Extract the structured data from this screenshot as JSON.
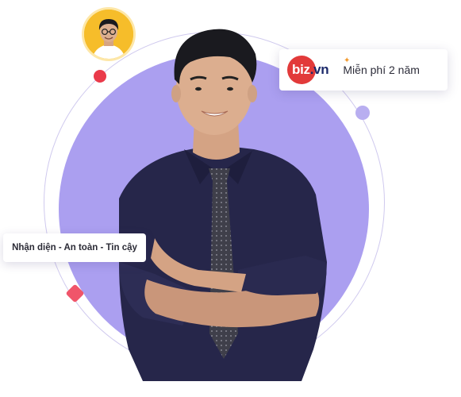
{
  "badge": {
    "logo_brand": "biz",
    "logo_tld": ".vn",
    "text": "Miễn phí 2 năm"
  },
  "pill": {
    "text": "Nhận diện - An toàn - Tin cậy"
  },
  "colors": {
    "disc": "#ab9ff0",
    "orbit": "#cfc9ee",
    "red_dot": "#ea3a4a",
    "lilac_dot": "#b8aef0",
    "diamond": "#f0556a",
    "avatar_bg": "#f6bd2a",
    "logo_red": "#e23a3a",
    "logo_navy": "#1c2a6b",
    "shirt": "#26264a",
    "tie": "#3f3f4a"
  }
}
